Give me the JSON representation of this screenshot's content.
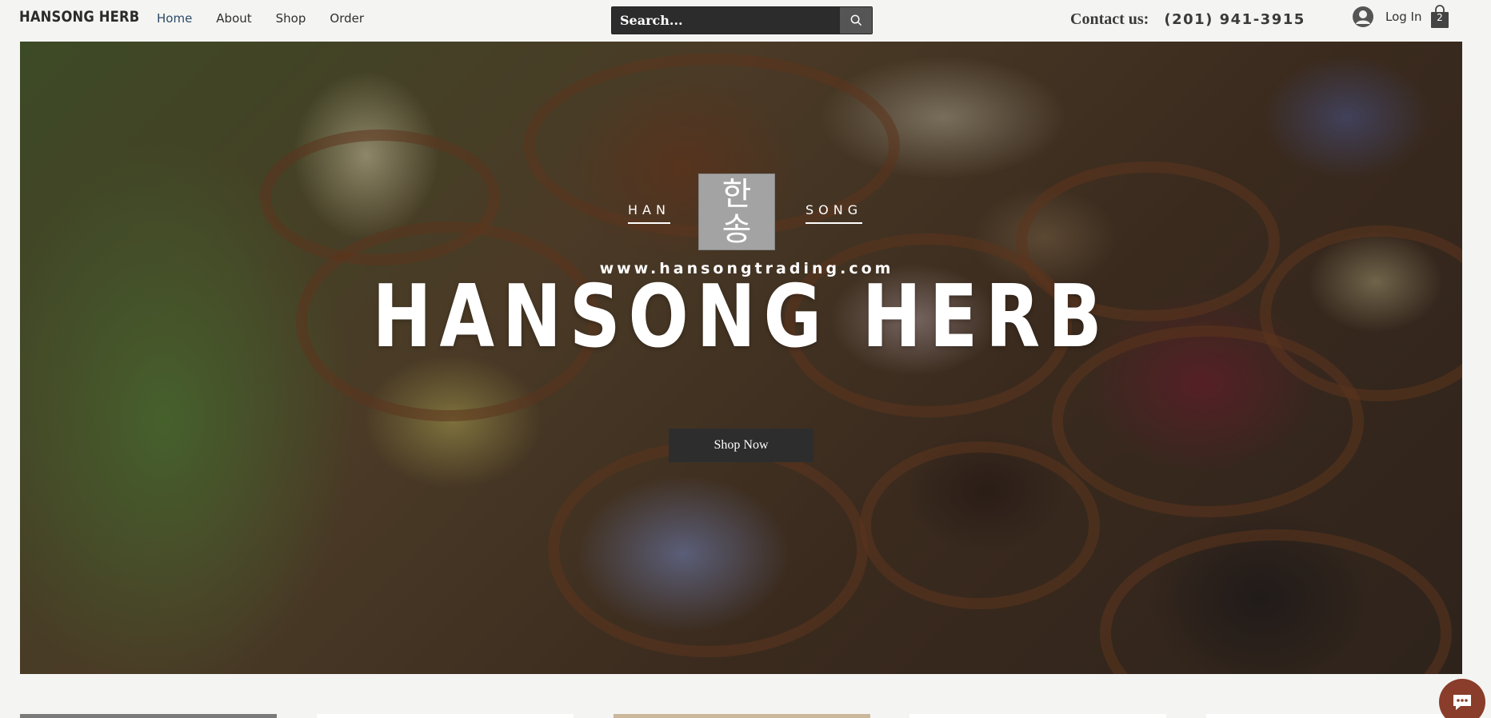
{
  "header": {
    "brand": "HANSONG HERB",
    "nav": [
      "Home",
      "About",
      "Shop",
      "Order"
    ],
    "active_nav": "Home",
    "search": {
      "placeholder": "Search..."
    },
    "contact_label": "Contact us:",
    "contact_phone": "(201) 941-3915",
    "login_label": "Log In",
    "cart_count": "2"
  },
  "hero": {
    "logo_left": "HAN",
    "logo_right": "SONG",
    "logo_korean_top": "한",
    "logo_korean_bottom": "송",
    "url": "www.hansongtrading.com",
    "title": "HANSONG HERB",
    "cta_label": "Shop Now"
  },
  "colors": {
    "page_background": "#f4f4f2",
    "search_background": "#2c2c2c",
    "cta_background": "#2d2d2d",
    "chat_bubble": "#8a3d2a"
  }
}
